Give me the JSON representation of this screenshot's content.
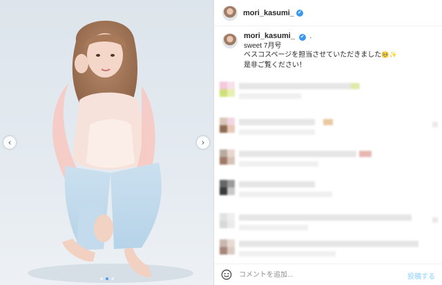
{
  "post": {
    "username": "mori_kasumi_",
    "verified_glyph": "✔",
    "caption_dot": ".",
    "caption_lines": [
      "sweet 7月号",
      "ベスコスページを担当させていただきました",
      "是非ご覧ください！"
    ],
    "caption_emoji": "🥺✨"
  },
  "media": {
    "prev_icon": "chevron-left-icon",
    "prev_glyph": "‹",
    "next_icon": "chevron-right-icon",
    "next_glyph": "›",
    "slide_count": 3,
    "active_slide": 2
  },
  "comment_bar": {
    "icon": "smile-icon",
    "placeholder": "コメントを追加...",
    "post_label": "投稿する"
  },
  "colors": {
    "accent": "#3897f0",
    "post_disabled": "#b2dffc",
    "background_photo": "#dfe7ee"
  }
}
